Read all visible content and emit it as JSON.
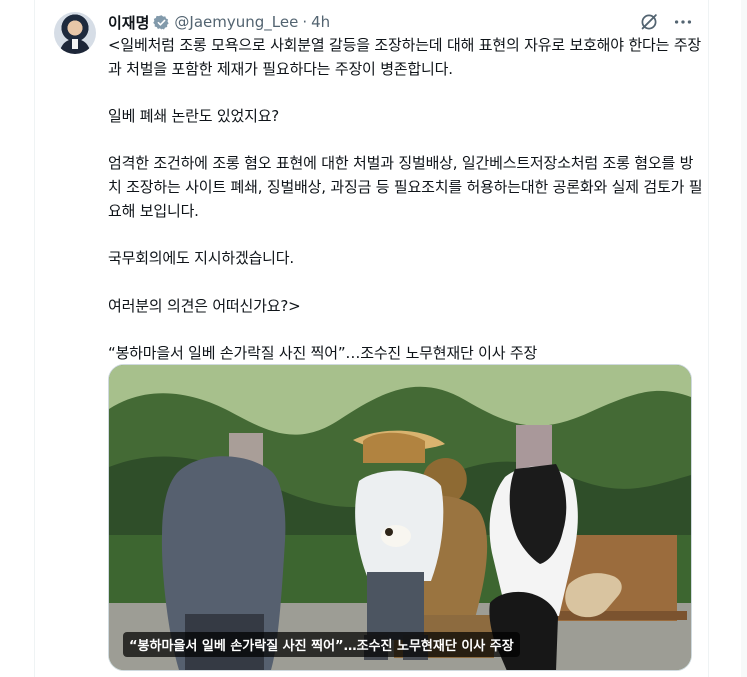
{
  "tweet": {
    "author_name": "이재명",
    "handle": "@Jaemyung_Lee",
    "separator": "·",
    "time": "4h",
    "paragraphs": [
      "<일베처럼 조롱 모욕으로 사회분열 갈등을 조장하는데 대해 표현의 자유로 보호해야 한다는 주장과 처벌을 포함한 제재가 필요하다는 주장이 병존합니다.",
      "일베 폐쇄 논란도 있었지요?",
      "엄격한 조건하에 조롱 혐오 표현에 대한 처벌과 징벌배상, 일간베스트저장소처럼 조롱 혐오를 방치 조장하는 사이트 폐쇄, 징벌배상, 과징금 등 필요조치를 허용하는대한 공론화와 실제 검토가 필요해 보입니다.",
      "국무회의에도 지시하겠습니다.",
      "여러분의 의견은 어떠신가요?>",
      "“봉하마을서 일베 손가락질 사진 찍어”…조수진 노무현재단 이사 주장"
    ],
    "media_caption": "“봉하마을서 일베 손가락질 사진 찍어”…조수진 노무현재단 이사 주장"
  },
  "icons": {
    "verified": "verified-badge-icon",
    "grok": "grok-icon",
    "more": "more-options-icon"
  },
  "colors": {
    "text": "#0f1419",
    "secondary": "#536471",
    "verified_badge": "#829aab",
    "border": "#cfd9de"
  }
}
